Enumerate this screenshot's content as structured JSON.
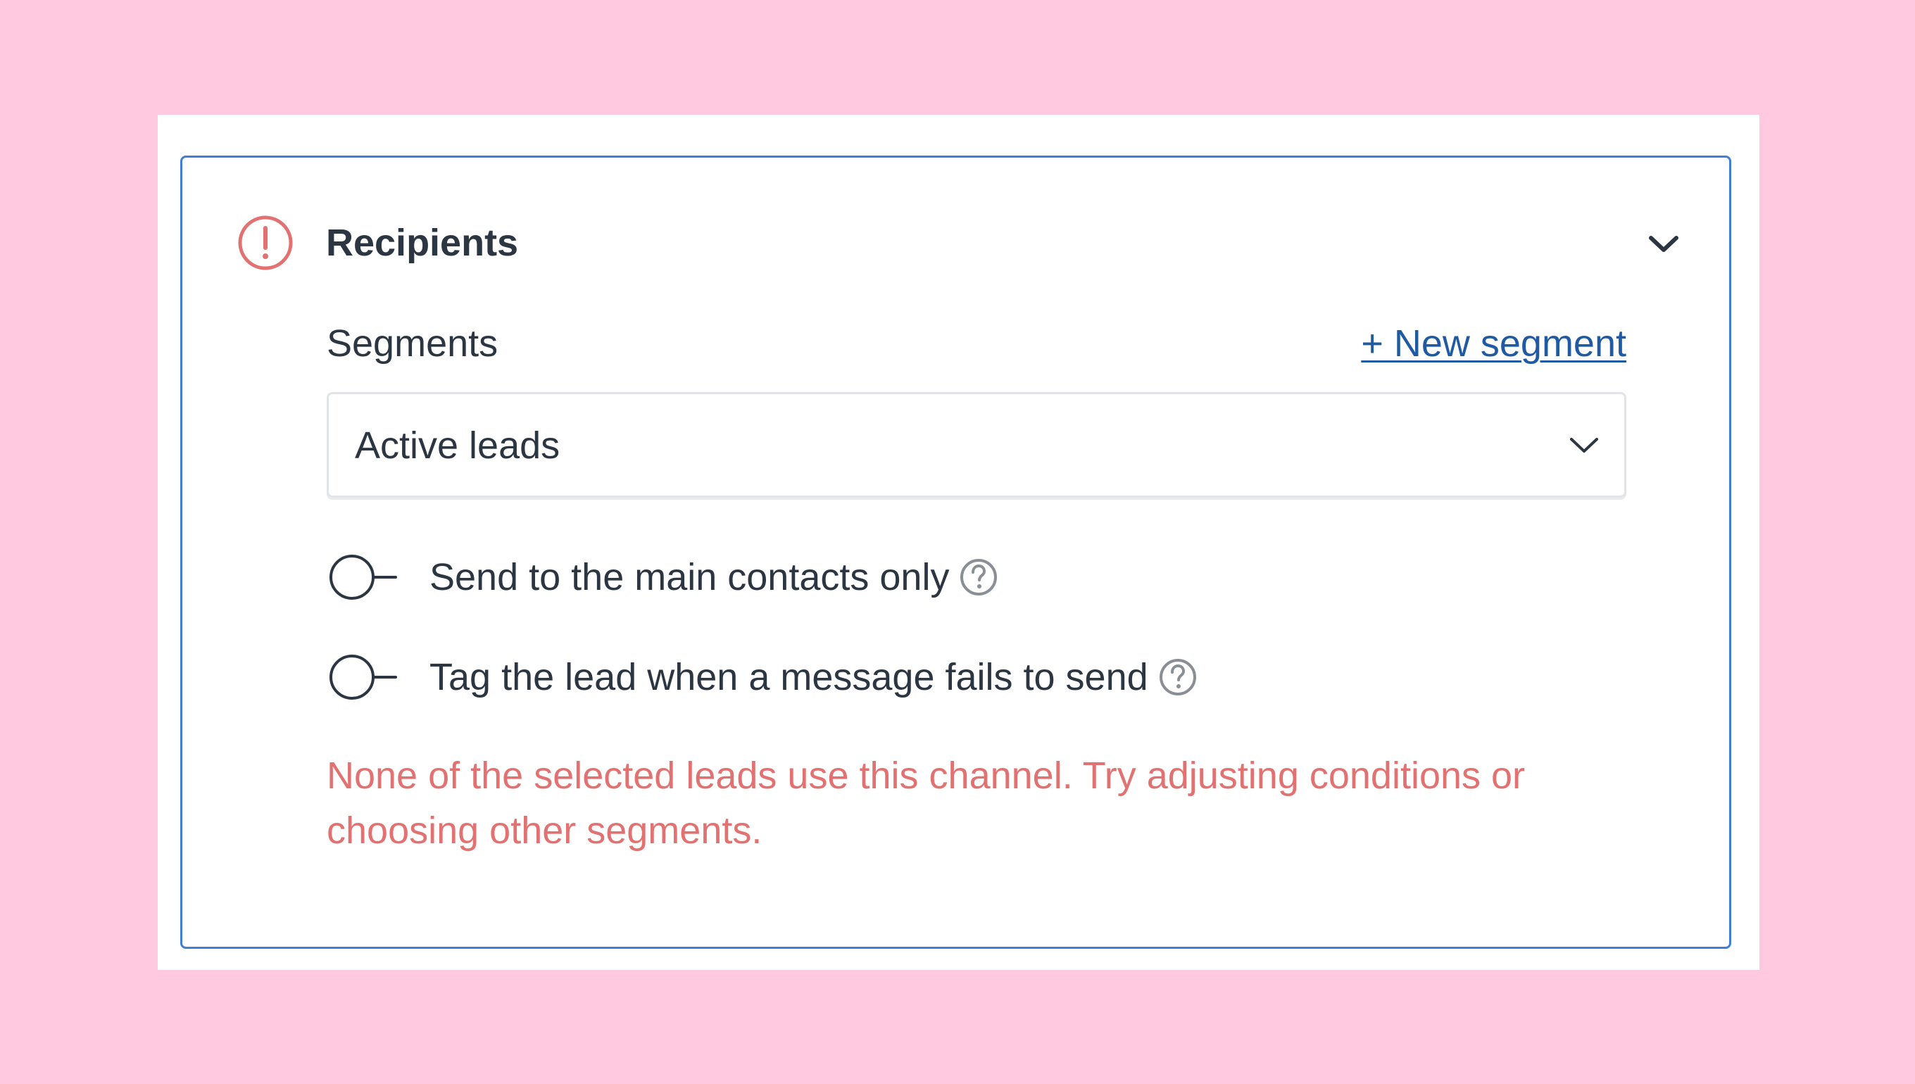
{
  "panel": {
    "title": "Recipients",
    "status_icon": "error-circle-icon",
    "collapse_icon": "chevron-down-icon",
    "accent_color": "#3f7fd6",
    "error_color": "#e27272"
  },
  "segments": {
    "label": "Segments",
    "new_segment_link": "+ New segment",
    "selected_value": "Active leads",
    "dropdown_icon": "chevron-down-icon"
  },
  "toggles": [
    {
      "label": "Send to the main contacts only",
      "enabled": false,
      "help_icon": "help-circle-icon"
    },
    {
      "label": "Tag the lead when a message fails to send",
      "enabled": false,
      "help_icon": "help-circle-icon"
    }
  ],
  "error_message": "None of the selected leads use this channel. Try adjusting conditions or choosing other segments."
}
